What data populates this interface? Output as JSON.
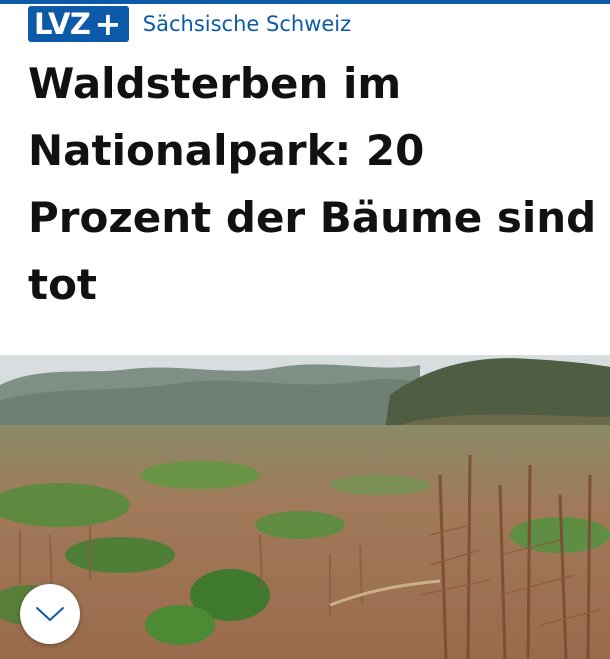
{
  "brand": {
    "name": "LVZ",
    "plus": "+",
    "color": "#0d5aa8"
  },
  "article": {
    "section": "Sächsische Schweiz",
    "headline_lines": [
      "Waldsterben im",
      "Nationalpark: 20",
      "Prozent der Bäume sind",
      "tot"
    ]
  },
  "hero_image": {
    "subject": "forest-landscape"
  },
  "controls": {
    "scroll_down_icon": "chevron-down-icon"
  }
}
